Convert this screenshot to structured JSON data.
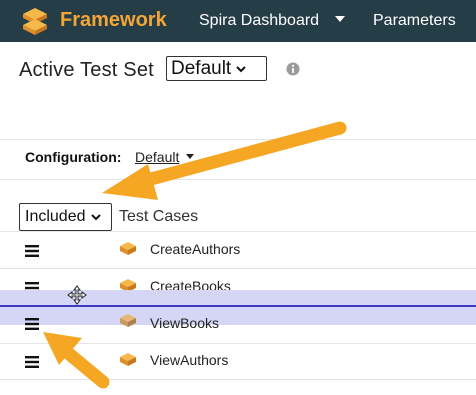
{
  "navbar": {
    "brand": "Framework",
    "items": [
      {
        "label": "Spira Dashboard"
      },
      {
        "label": "Parameters"
      }
    ]
  },
  "header": {
    "title": "Active Test Set",
    "test_set_select": "Default",
    "info_icon": "info-icon"
  },
  "configuration": {
    "label": "Configuration:",
    "value": "Default"
  },
  "filter": {
    "included_select": "Included"
  },
  "table": {
    "column_header": "Test Cases",
    "rows": [
      {
        "name": "CreateAuthors",
        "icon": "test-case-icon"
      },
      {
        "name": "CreateBooks",
        "icon": "test-case-icon"
      },
      {
        "name": "ViewBooks",
        "icon": "test-case-icon",
        "dragging": true
      },
      {
        "name": "ViewAuthors",
        "icon": "test-case-icon"
      }
    ]
  },
  "colors": {
    "navbar_bg": "#253d47",
    "brand": "#f3a536",
    "row_highlight": "#d5d5f6",
    "drop_line": "#3c3cc0",
    "annotation_arrow": "#f5a623"
  }
}
